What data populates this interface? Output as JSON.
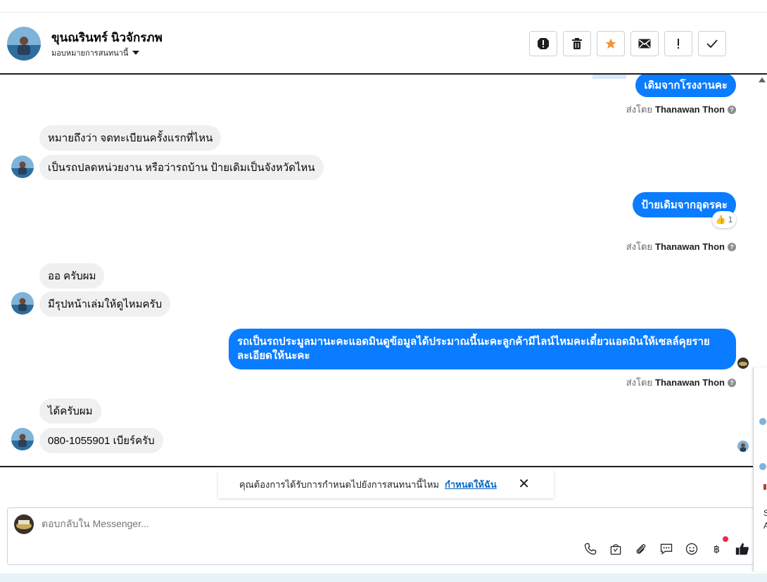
{
  "header": {
    "contact_name": "ขุนณรินทร์ นิวจักรภพ",
    "assign_label": "มอบหมายการสนทนานี้",
    "actions": [
      "spam-icon",
      "trash-icon",
      "star-icon",
      "envelope-icon",
      "exclamation-icon",
      "check-icon"
    ]
  },
  "messages": {
    "m1_text": "เดิมจากโรงงานคะ",
    "sent_by_prefix": "ส่งโดย",
    "sent_by_name": "Thanawan Thon",
    "m2_text": "หมายถึงว่า จดทะเบียนครั้งแรกที่ไหน",
    "m3_text": "เป็นรถปลดหน่วยงาน หรือว่ารถบ้าน ป้ายเดิมเป็นจังหวัดไหน",
    "m4_text": "ป้ายเดิมจากอุดรคะ",
    "m4_reaction_count": "1",
    "m5_text": "ออ ครับผม",
    "m6_text": "มีรุปหน้าเล่มให้ดูไหมครับ",
    "m7_text": "รถเป็นรถประมูลมานะคะแอดมินดูข้อมูลได้ประมาณนี้นะคะลูกค้ามีไลน์ไหมคะเดี๋ยวแอดมินให้เซลล์คุยรายละเอียดให้นะคะ",
    "m8_text": "ได้ครับผม",
    "m9_text": "080-1055901 เบียร์ครับ"
  },
  "banner": {
    "text": "คุณต้องการได้รับการกำหนดไปยังการสนทนานี้ไหม",
    "link": "กำหนดให้ฉัน",
    "close": "✕"
  },
  "composer": {
    "placeholder": "ตอบกลับใน Messenger...",
    "tools": [
      "phone-icon",
      "shopping-bag-icon",
      "paperclip-icon",
      "chat-bubble-icon",
      "emoji-icon",
      "baht-icon",
      "thumbs-up-icon"
    ]
  },
  "right_panel": {
    "line1": "S",
    "line2": "A"
  }
}
